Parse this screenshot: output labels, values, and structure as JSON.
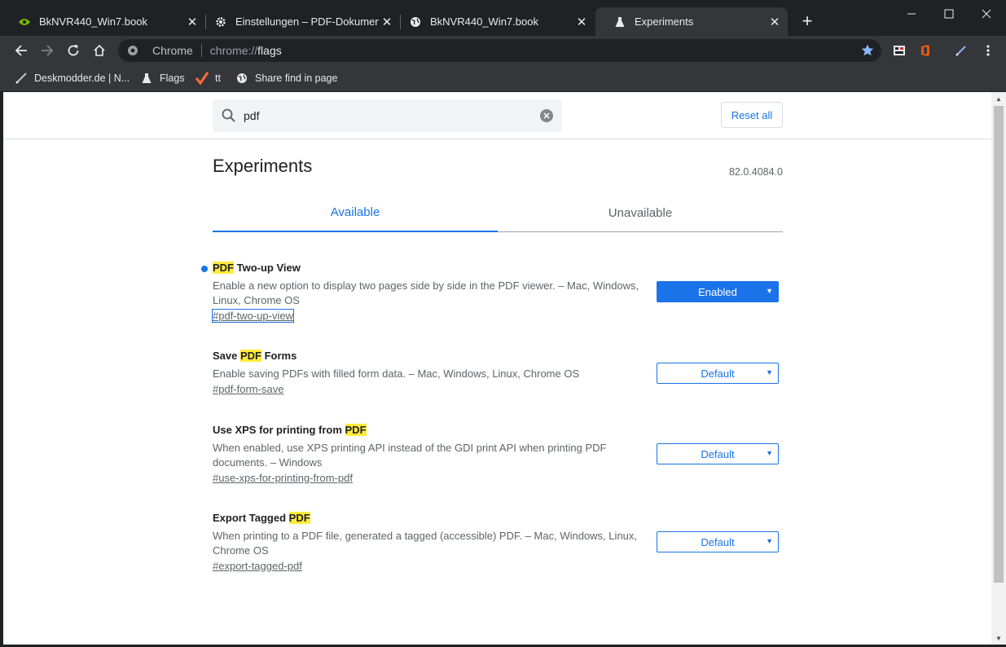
{
  "tabs": [
    {
      "title": "BkNVR440_Win7.book",
      "icon": "nvidia-icon"
    },
    {
      "title": "Einstellungen – PDF-Dokumente",
      "icon": "gear-icon"
    },
    {
      "title": "BkNVR440_Win7.book",
      "icon": "globe-icon"
    },
    {
      "title": "Experiments",
      "icon": "flask-icon",
      "active": true
    }
  ],
  "omnibox": {
    "chip": "Chrome",
    "url_scheme": "chrome://",
    "url_host": "flags"
  },
  "bookmarks": [
    {
      "label": "Deskmodder.de | N...",
      "icon": "pen-icon"
    },
    {
      "label": "Flags",
      "icon": "flask-icon"
    },
    {
      "label": "tt",
      "icon": "checkmark-icon"
    },
    {
      "label": "Share find in page",
      "icon": "globe-icon"
    }
  ],
  "search": {
    "value": "pdf",
    "reset_label": "Reset all"
  },
  "page": {
    "title": "Experiments",
    "version": "82.0.4084.0",
    "tab_available": "Available",
    "tab_unavailable": "Unavailable"
  },
  "experiments": [
    {
      "name_pre": "",
      "name_hl": "PDF",
      "name_post": " Two-up View",
      "description": "Enable a new option to display two pages side by side in the PDF viewer. – Mac, Windows, Linux, Chrome OS",
      "link": "#pdf-two-up-view",
      "state": "Enabled",
      "modified": true
    },
    {
      "name_pre": "Save ",
      "name_hl": "PDF",
      "name_post": " Forms",
      "description": "Enable saving PDFs with filled form data. – Mac, Windows, Linux, Chrome OS",
      "link": "#pdf-form-save",
      "state": "Default",
      "modified": false
    },
    {
      "name_pre": "Use XPS for printing from ",
      "name_hl": "PDF",
      "name_post": "",
      "description": "When enabled, use XPS printing API instead of the GDI print API when printing PDF documents. – Windows",
      "link": "#use-xps-for-printing-from-pdf",
      "state": "Default",
      "modified": false
    },
    {
      "name_pre": "Export Tagged ",
      "name_hl": "PDF",
      "name_post": "",
      "description": "When printing to a PDF file, generated a tagged (accessible) PDF. – Mac, Windows, Linux, Chrome OS",
      "link": "#export-tagged-pdf",
      "state": "Default",
      "modified": false
    }
  ],
  "colors": {
    "accent": "#1a73e8",
    "highlight": "#ffeb3b",
    "frame": "#202124",
    "toolbar": "#35363a"
  }
}
